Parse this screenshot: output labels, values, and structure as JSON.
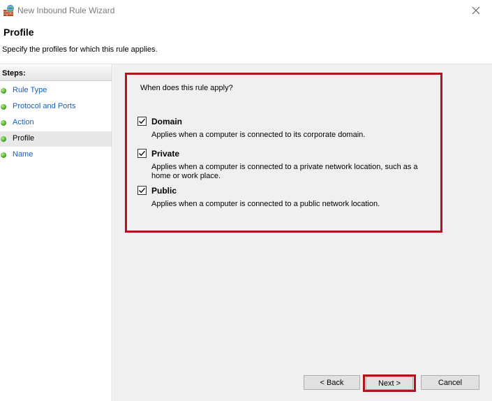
{
  "window": {
    "title": "New Inbound Rule Wizard"
  },
  "header": {
    "title": "Profile",
    "subtitle": "Specify the profiles for which this rule applies."
  },
  "sidebar": {
    "heading": "Steps:",
    "items": [
      {
        "label": "Rule Type",
        "active": false
      },
      {
        "label": "Protocol and Ports",
        "active": false
      },
      {
        "label": "Action",
        "active": false
      },
      {
        "label": "Profile",
        "active": true
      },
      {
        "label": "Name",
        "active": false
      }
    ]
  },
  "main": {
    "question": "When does this rule apply?",
    "options": [
      {
        "label": "Domain",
        "checked": true,
        "description": "Applies when a computer is connected to its corporate domain."
      },
      {
        "label": "Private",
        "checked": true,
        "description": "Applies when a computer is connected to a private network location, such as a home or work place."
      },
      {
        "label": "Public",
        "checked": true,
        "description": "Applies when a computer is connected to a public network location."
      }
    ]
  },
  "buttons": {
    "back": "< Back",
    "next": "Next >",
    "cancel": "Cancel"
  },
  "colors": {
    "highlight": "#b0141c",
    "link": "#1a5fb4",
    "content_bg": "#f0f0f0"
  },
  "icons": {
    "app": "firewall-icon",
    "close": "close-icon",
    "check": "checkmark-icon",
    "step": "green-dot-icon"
  }
}
